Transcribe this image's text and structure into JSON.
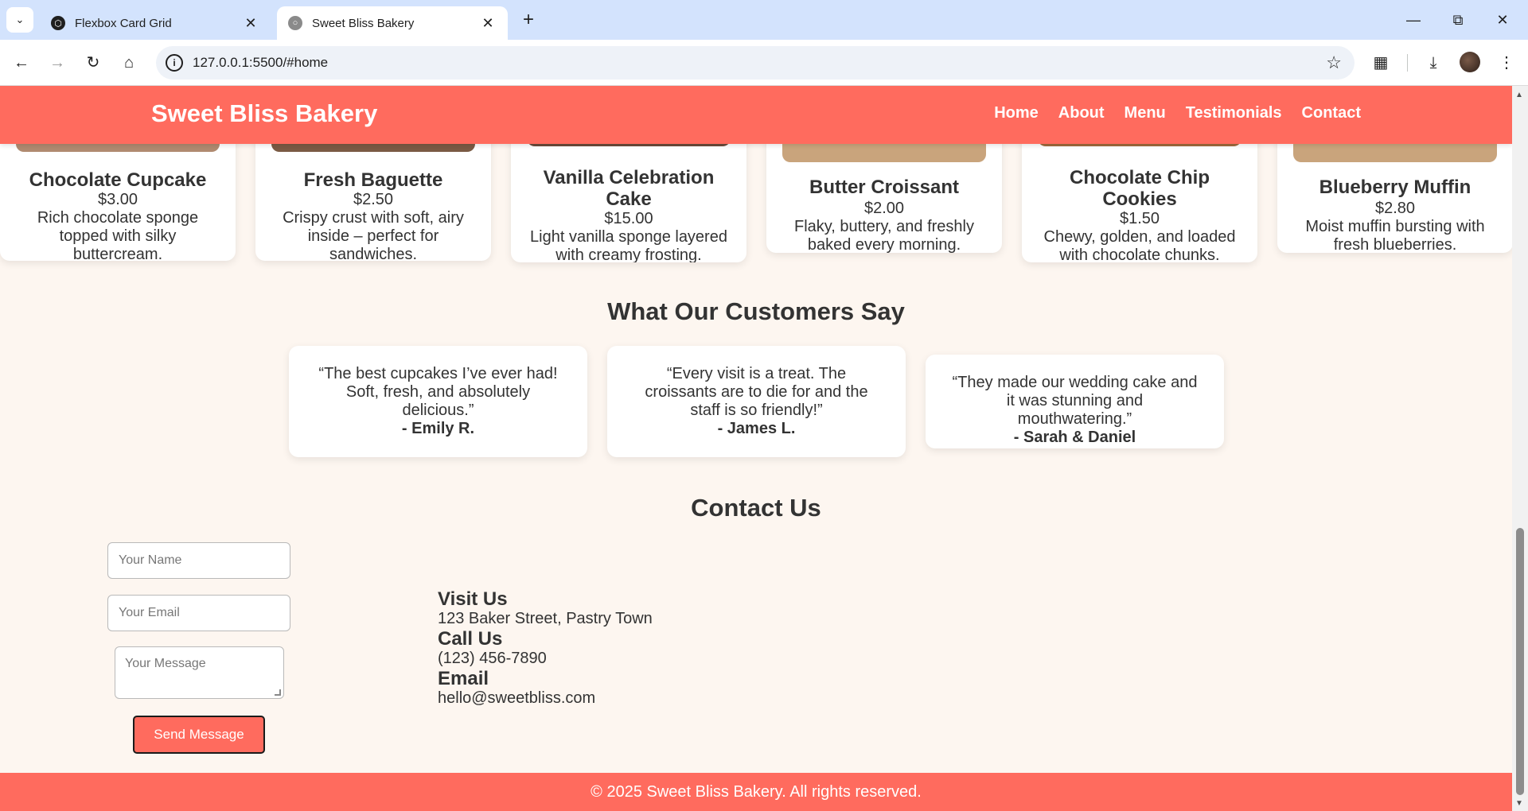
{
  "browser": {
    "tabs": [
      {
        "title": "Flexbox Card Grid",
        "icon": "codepen-icon"
      },
      {
        "title": "Sweet Bliss Bakery",
        "icon": "globe-icon"
      }
    ],
    "url": "127.0.0.1:5500/#home"
  },
  "header": {
    "logo": "Sweet Bliss Bakery",
    "nav": [
      "Home",
      "About",
      "Menu",
      "Testimonials",
      "Contact"
    ]
  },
  "menu": {
    "items": [
      {
        "name": "Chocolate Cupcake",
        "price": "$3.00",
        "desc": "Rich chocolate sponge topped with silky buttercream."
      },
      {
        "name": "Fresh Baguette",
        "price": "$2.50",
        "desc": "Crispy crust with soft, airy inside – perfect for sandwiches."
      },
      {
        "name": "Vanilla Celebration Cake",
        "price": "$15.00",
        "desc": "Light vanilla sponge layered with creamy frosting."
      },
      {
        "name": "Butter Croissant",
        "price": "$2.00",
        "desc": "Flaky, buttery, and freshly baked every morning."
      },
      {
        "name": "Chocolate Chip Cookies",
        "price": "$1.50",
        "desc": "Chewy, golden, and loaded with chocolate chunks."
      },
      {
        "name": "Blueberry Muffin",
        "price": "$2.80",
        "desc": "Moist muffin bursting with fresh blueberries."
      }
    ]
  },
  "testimonials": {
    "title": "What Our Customers Say",
    "items": [
      {
        "quote": "“The best cupcakes I’ve ever had! Soft, fresh, and absolutely delicious.”",
        "author": "- Emily R."
      },
      {
        "quote": "“Every visit is a treat. The croissants are to die for and the staff is so friendly!”",
        "author": "- James L."
      },
      {
        "quote": "“They made our wedding cake and it was stunning and mouthwatering.”",
        "author": "- Sarah & Daniel"
      }
    ]
  },
  "contact": {
    "title": "Contact Us",
    "name_placeholder": "Your Name",
    "email_placeholder": "Your Email",
    "message_placeholder": "Your Message",
    "send_label": "Send Message",
    "visit_label": "Visit Us",
    "address": "123 Baker Street, Pastry Town",
    "call_label": "Call Us",
    "phone": "(123) 456-7890",
    "email_label": "Email",
    "email": "hello@sweetbliss.com"
  },
  "footer": {
    "text": "© 2025 Sweet Bliss Bakery. All rights reserved."
  },
  "colors": {
    "brand": "#ff6b5e",
    "background": "#fdf6f0",
    "card": "#ffffff"
  }
}
